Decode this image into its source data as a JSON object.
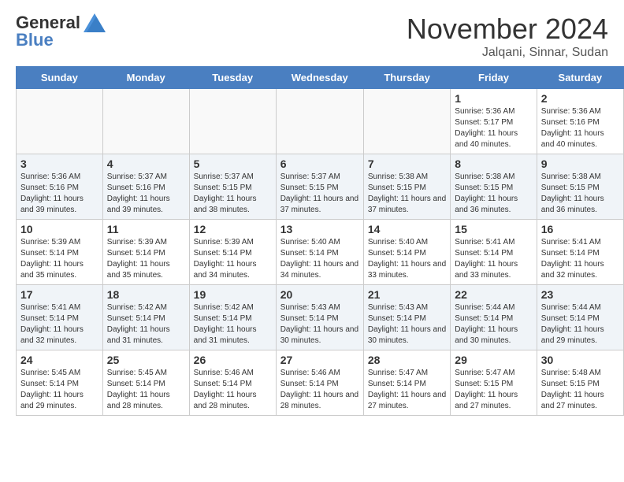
{
  "header": {
    "logo": {
      "general": "General",
      "blue": "Blue"
    },
    "month_title": "November 2024",
    "location": "Jalqani, Sinnar, Sudan"
  },
  "calendar": {
    "days_of_week": [
      "Sunday",
      "Monday",
      "Tuesday",
      "Wednesday",
      "Thursday",
      "Friday",
      "Saturday"
    ],
    "weeks": [
      {
        "row_shade": false,
        "days": [
          {
            "day": "",
            "empty": true,
            "detail": ""
          },
          {
            "day": "",
            "empty": true,
            "detail": ""
          },
          {
            "day": "",
            "empty": true,
            "detail": ""
          },
          {
            "day": "",
            "empty": true,
            "detail": ""
          },
          {
            "day": "",
            "empty": true,
            "detail": ""
          },
          {
            "day": "1",
            "empty": false,
            "detail": "Sunrise: 5:36 AM\nSunset: 5:17 PM\nDaylight: 11 hours\nand 40 minutes."
          },
          {
            "day": "2",
            "empty": false,
            "detail": "Sunrise: 5:36 AM\nSunset: 5:16 PM\nDaylight: 11 hours\nand 40 minutes."
          }
        ]
      },
      {
        "row_shade": true,
        "days": [
          {
            "day": "3",
            "empty": false,
            "detail": "Sunrise: 5:36 AM\nSunset: 5:16 PM\nDaylight: 11 hours\nand 39 minutes."
          },
          {
            "day": "4",
            "empty": false,
            "detail": "Sunrise: 5:37 AM\nSunset: 5:16 PM\nDaylight: 11 hours\nand 39 minutes."
          },
          {
            "day": "5",
            "empty": false,
            "detail": "Sunrise: 5:37 AM\nSunset: 5:15 PM\nDaylight: 11 hours\nand 38 minutes."
          },
          {
            "day": "6",
            "empty": false,
            "detail": "Sunrise: 5:37 AM\nSunset: 5:15 PM\nDaylight: 11 hours\nand 37 minutes."
          },
          {
            "day": "7",
            "empty": false,
            "detail": "Sunrise: 5:38 AM\nSunset: 5:15 PM\nDaylight: 11 hours\nand 37 minutes."
          },
          {
            "day": "8",
            "empty": false,
            "detail": "Sunrise: 5:38 AM\nSunset: 5:15 PM\nDaylight: 11 hours\nand 36 minutes."
          },
          {
            "day": "9",
            "empty": false,
            "detail": "Sunrise: 5:38 AM\nSunset: 5:15 PM\nDaylight: 11 hours\nand 36 minutes."
          }
        ]
      },
      {
        "row_shade": false,
        "days": [
          {
            "day": "10",
            "empty": false,
            "detail": "Sunrise: 5:39 AM\nSunset: 5:14 PM\nDaylight: 11 hours\nand 35 minutes."
          },
          {
            "day": "11",
            "empty": false,
            "detail": "Sunrise: 5:39 AM\nSunset: 5:14 PM\nDaylight: 11 hours\nand 35 minutes."
          },
          {
            "day": "12",
            "empty": false,
            "detail": "Sunrise: 5:39 AM\nSunset: 5:14 PM\nDaylight: 11 hours\nand 34 minutes."
          },
          {
            "day": "13",
            "empty": false,
            "detail": "Sunrise: 5:40 AM\nSunset: 5:14 PM\nDaylight: 11 hours\nand 34 minutes."
          },
          {
            "day": "14",
            "empty": false,
            "detail": "Sunrise: 5:40 AM\nSunset: 5:14 PM\nDaylight: 11 hours\nand 33 minutes."
          },
          {
            "day": "15",
            "empty": false,
            "detail": "Sunrise: 5:41 AM\nSunset: 5:14 PM\nDaylight: 11 hours\nand 33 minutes."
          },
          {
            "day": "16",
            "empty": false,
            "detail": "Sunrise: 5:41 AM\nSunset: 5:14 PM\nDaylight: 11 hours\nand 32 minutes."
          }
        ]
      },
      {
        "row_shade": true,
        "days": [
          {
            "day": "17",
            "empty": false,
            "detail": "Sunrise: 5:41 AM\nSunset: 5:14 PM\nDaylight: 11 hours\nand 32 minutes."
          },
          {
            "day": "18",
            "empty": false,
            "detail": "Sunrise: 5:42 AM\nSunset: 5:14 PM\nDaylight: 11 hours\nand 31 minutes."
          },
          {
            "day": "19",
            "empty": false,
            "detail": "Sunrise: 5:42 AM\nSunset: 5:14 PM\nDaylight: 11 hours\nand 31 minutes."
          },
          {
            "day": "20",
            "empty": false,
            "detail": "Sunrise: 5:43 AM\nSunset: 5:14 PM\nDaylight: 11 hours\nand 30 minutes."
          },
          {
            "day": "21",
            "empty": false,
            "detail": "Sunrise: 5:43 AM\nSunset: 5:14 PM\nDaylight: 11 hours\nand 30 minutes."
          },
          {
            "day": "22",
            "empty": false,
            "detail": "Sunrise: 5:44 AM\nSunset: 5:14 PM\nDaylight: 11 hours\nand 30 minutes."
          },
          {
            "day": "23",
            "empty": false,
            "detail": "Sunrise: 5:44 AM\nSunset: 5:14 PM\nDaylight: 11 hours\nand 29 minutes."
          }
        ]
      },
      {
        "row_shade": false,
        "days": [
          {
            "day": "24",
            "empty": false,
            "detail": "Sunrise: 5:45 AM\nSunset: 5:14 PM\nDaylight: 11 hours\nand 29 minutes."
          },
          {
            "day": "25",
            "empty": false,
            "detail": "Sunrise: 5:45 AM\nSunset: 5:14 PM\nDaylight: 11 hours\nand 28 minutes."
          },
          {
            "day": "26",
            "empty": false,
            "detail": "Sunrise: 5:46 AM\nSunset: 5:14 PM\nDaylight: 11 hours\nand 28 minutes."
          },
          {
            "day": "27",
            "empty": false,
            "detail": "Sunrise: 5:46 AM\nSunset: 5:14 PM\nDaylight: 11 hours\nand 28 minutes."
          },
          {
            "day": "28",
            "empty": false,
            "detail": "Sunrise: 5:47 AM\nSunset: 5:14 PM\nDaylight: 11 hours\nand 27 minutes."
          },
          {
            "day": "29",
            "empty": false,
            "detail": "Sunrise: 5:47 AM\nSunset: 5:15 PM\nDaylight: 11 hours\nand 27 minutes."
          },
          {
            "day": "30",
            "empty": false,
            "detail": "Sunrise: 5:48 AM\nSunset: 5:15 PM\nDaylight: 11 hours\nand 27 minutes."
          }
        ]
      }
    ]
  }
}
